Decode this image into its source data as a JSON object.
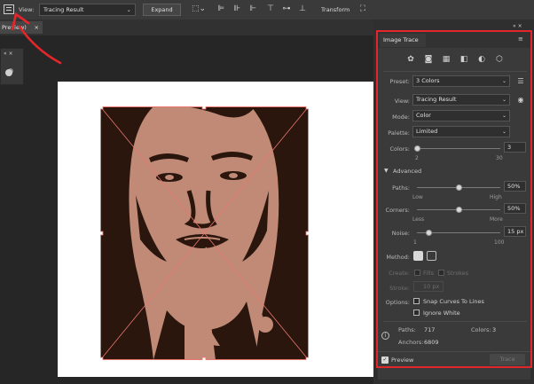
{
  "toolbar": {
    "view_label": "View:",
    "view_value": "Tracing Result",
    "expand": "Expand",
    "transform": "Transform",
    "trace_icon": "image-trace-panel-icon"
  },
  "document_tab": {
    "name": "Preview)",
    "close": "×"
  },
  "panel": {
    "title": "Image Trace",
    "preset_label": "Preset:",
    "preset_value": "3 Colors",
    "view_label": "View:",
    "view_value": "Tracing Result",
    "mode_label": "Mode:",
    "mode_value": "Color",
    "palette_label": "Palette:",
    "palette_value": "Limited",
    "colors_label": "Colors:",
    "colors_value": "3",
    "colors_min": "2",
    "colors_max": "30",
    "colors_level": 0.0,
    "advanced": "Advanced",
    "paths_label": "Paths:",
    "paths_value": "50%",
    "paths_low": "Low",
    "paths_high": "High",
    "paths_level": 0.5,
    "corners_label": "Corners:",
    "corners_value": "50%",
    "corners_less": "Less",
    "corners_more": "More",
    "corners_level": 0.5,
    "noise_label": "Noise:",
    "noise_value": "15 px",
    "noise_min": "1",
    "noise_max": "100",
    "noise_level": 0.14,
    "method_label": "Method:",
    "create_label": "Create:",
    "fills": "Fills",
    "strokes": "Strokes",
    "stroke_label": "Stroke:",
    "stroke_value": "10 px",
    "options_label": "Options:",
    "snap": "Snap Curves To Lines",
    "ignore_white": "Ignore White",
    "paths_stat_label": "Paths:",
    "paths_stat": "717",
    "colors_stat_label": "Colors:",
    "colors_stat": "3",
    "anchors_stat_label": "Anchors:",
    "anchors_stat": "6809",
    "preview": "Preview",
    "trace": "Trace"
  },
  "colors": {
    "annotation_red": "#e3262b",
    "trace_light": "#c08a77",
    "trace_dark": "#2a160d"
  }
}
